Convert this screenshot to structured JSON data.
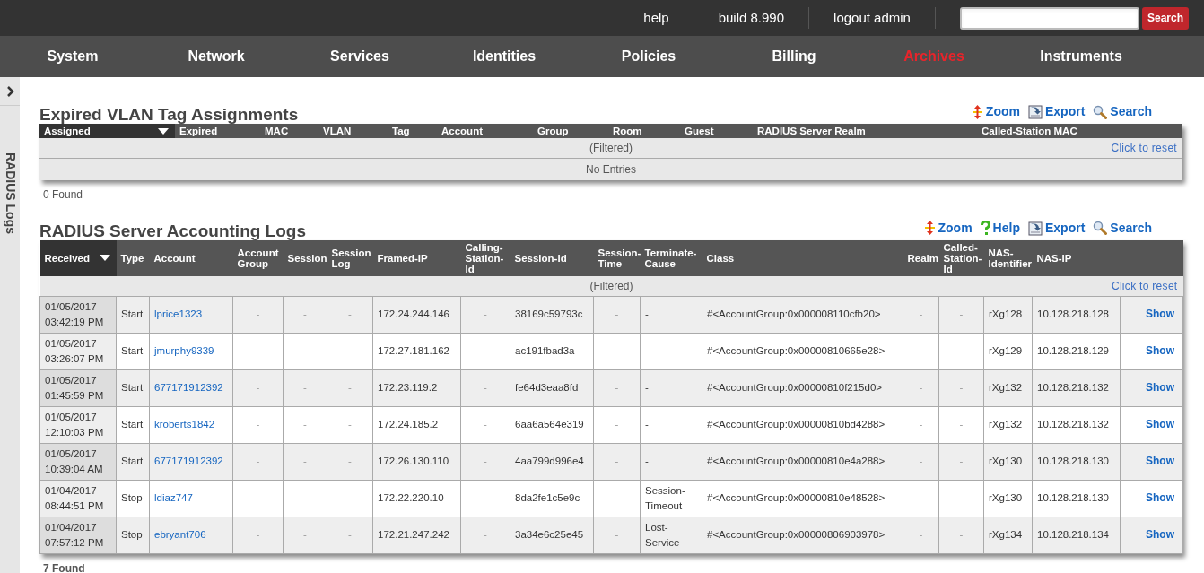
{
  "top_links": [
    "help",
    "build 8.990",
    "logout admin"
  ],
  "search": {
    "button": "Search"
  },
  "nav": [
    {
      "label": "System",
      "selected": false
    },
    {
      "label": "Network",
      "selected": false
    },
    {
      "label": "Services",
      "selected": false
    },
    {
      "label": "Identities",
      "selected": false
    },
    {
      "label": "Policies",
      "selected": false
    },
    {
      "label": "Billing",
      "selected": false
    },
    {
      "label": "Archives",
      "selected": true
    },
    {
      "label": "Instruments",
      "selected": false
    }
  ],
  "side_tab": {
    "label": "RADIUS Logs"
  },
  "panels": [
    {
      "title": "Expired VLAN Tag Assignments",
      "actions": [
        {
          "kind": "zoom",
          "label": "Zoom"
        },
        {
          "kind": "export",
          "label": "Export"
        },
        {
          "kind": "search",
          "label": "Search"
        }
      ],
      "columns": [
        {
          "label": "Assigned",
          "sorted": true
        },
        {
          "label": "Expired",
          "sorted": false
        },
        {
          "label": "MAC",
          "sorted": false
        },
        {
          "label": "VLAN",
          "sorted": false
        },
        {
          "label": "Tag",
          "sorted": false
        },
        {
          "label": "Account",
          "sorted": false
        },
        {
          "label": "Group",
          "sorted": false
        },
        {
          "label": "Room",
          "sorted": false
        },
        {
          "label": "Guest",
          "sorted": false
        },
        {
          "label": "RADIUS Server Realm",
          "sorted": false
        },
        {
          "label": "Called-Station MAC",
          "sorted": false
        }
      ],
      "filter_text": "(Filtered)",
      "reset": "Click to reset",
      "empty_text": "No Entries",
      "footer": "0 Found"
    },
    {
      "title": "RADIUS Server Accounting Logs",
      "actions": [
        {
          "kind": "zoom",
          "label": "Zoom"
        },
        {
          "kind": "help",
          "label": "Help"
        },
        {
          "kind": "export",
          "label": "Export"
        },
        {
          "kind": "search",
          "label": "Search"
        }
      ],
      "columns": [
        {
          "label": "Received",
          "sorted": true
        },
        {
          "label": "Type",
          "sorted": false
        },
        {
          "label": "Account",
          "sorted": false,
          "kind": "link"
        },
        {
          "label": "Account Group",
          "sorted": false,
          "kind": "dash"
        },
        {
          "label": "Session",
          "sorted": false,
          "kind": "dash"
        },
        {
          "label": "Session Log",
          "sorted": false,
          "kind": "dash"
        },
        {
          "label": "Framed-IP",
          "sorted": false
        },
        {
          "label": "Calling-Station-Id",
          "sorted": false,
          "kind": "dash"
        },
        {
          "label": "Session-Id",
          "sorted": false
        },
        {
          "label": "Session-Time",
          "sorted": false,
          "kind": "dash"
        },
        {
          "label": "Terminate-Cause",
          "sorted": false
        },
        {
          "label": "Class",
          "sorted": false
        },
        {
          "label": "Realm",
          "sorted": false,
          "kind": "dash"
        },
        {
          "label": "Called-Station-Id",
          "sorted": false,
          "kind": "dash"
        },
        {
          "label": "NAS-Identifier",
          "sorted": false
        },
        {
          "label": "NAS-IP",
          "sorted": false
        }
      ],
      "filter_text": "(Filtered)",
      "reset": "Click to reset",
      "rows": [
        {
          "cells": [
            "01/05/2017 03:42:19 PM",
            "Start",
            "lprice1323",
            "-",
            "-",
            "-",
            "172.24.244.146",
            "-",
            "38169c59793c",
            "-",
            "-",
            "#<AccountGroup:0x000008110cfb20>",
            "-",
            "-",
            "rXg128",
            "10.128.218.128"
          ],
          "action": "Show"
        },
        {
          "cells": [
            "01/05/2017 03:26:07 PM",
            "Start",
            "jmurphy9339",
            "-",
            "-",
            "-",
            "172.27.181.162",
            "-",
            "ac191fbad3a",
            "-",
            "-",
            "#<AccountGroup:0x00000810665e28>",
            "-",
            "-",
            "rXg129",
            "10.128.218.129"
          ],
          "action": "Show"
        },
        {
          "cells": [
            "01/05/2017 01:45:59 PM",
            "Start",
            "677171912392",
            "-",
            "-",
            "-",
            "172.23.119.2",
            "-",
            "fe64d3eaa8fd",
            "-",
            "-",
            "#<AccountGroup:0x00000810f215d0>",
            "-",
            "-",
            "rXg132",
            "10.128.218.132"
          ],
          "action": "Show"
        },
        {
          "cells": [
            "01/05/2017 12:10:03 PM",
            "Start",
            "kroberts1842",
            "-",
            "-",
            "-",
            "172.24.185.2",
            "-",
            "6aa6a564e319",
            "-",
            "-",
            "#<AccountGroup:0x00000810bd4288>",
            "-",
            "-",
            "rXg132",
            "10.128.218.132"
          ],
          "action": "Show"
        },
        {
          "cells": [
            "01/05/2017 10:39:04 AM",
            "Start",
            "677171912392",
            "-",
            "-",
            "-",
            "172.26.130.110",
            "-",
            "4aa799d996e4",
            "-",
            "-",
            "#<AccountGroup:0x00000810e4a288>",
            "-",
            "-",
            "rXg130",
            "10.128.218.130"
          ],
          "action": "Show"
        },
        {
          "cells": [
            "01/04/2017 08:44:51 PM",
            "Stop",
            "ldiaz747",
            "-",
            "-",
            "-",
            "172.22.220.10",
            "-",
            "8da2fe1c5e9c",
            "-",
            "Session-Timeout",
            "#<AccountGroup:0x00000810e48528>",
            "-",
            "-",
            "rXg130",
            "10.128.218.130"
          ],
          "action": "Show"
        },
        {
          "cells": [
            "01/04/2017 07:57:12 PM",
            "Stop",
            "ebryant706",
            "-",
            "-",
            "-",
            "172.21.247.242",
            "-",
            "3a34e6c25e45",
            "-",
            "Lost-Service",
            "#<AccountGroup:0x00000806903978>",
            "-",
            "-",
            "rXg134",
            "10.128.218.134"
          ],
          "action": "Show"
        }
      ],
      "footer": "7 Found"
    }
  ]
}
